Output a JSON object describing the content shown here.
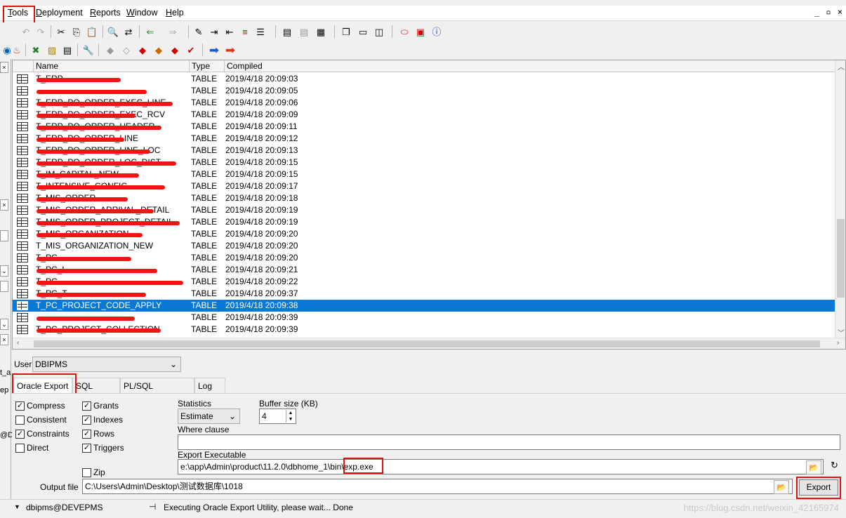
{
  "menu": {
    "tools": "Tools",
    "deployment": "Deployment",
    "reports": "Reports",
    "window": "Window",
    "help": "Help",
    "window_controls": "_ ▫ ×"
  },
  "grid": {
    "headers": {
      "name": "Name",
      "type": "Type",
      "compiled": "Compiled"
    },
    "rows": [
      {
        "name": "T_ERP",
        "type": "TABLE",
        "compiled": "2019/4/18 20:09:03"
      },
      {
        "name": "",
        "type": "TABLE",
        "compiled": "2019/4/18 20:09:05"
      },
      {
        "name": "T_ERP_PO_ORDER_EXEC_LINE",
        "type": "TABLE",
        "compiled": "2019/4/18 20:09:06"
      },
      {
        "name": "T_ERP_PO_ORDER_EXEC_RCV",
        "type": "TABLE",
        "compiled": "2019/4/18 20:09:09"
      },
      {
        "name": "T_ERP_PO_ORDER_HEADER",
        "type": "TABLE",
        "compiled": "2019/4/18 20:09:11"
      },
      {
        "name": "T_ERP_PO_ORDER_LINE",
        "type": "TABLE",
        "compiled": "2019/4/18 20:09:12"
      },
      {
        "name": "T_ERP_PO_ORDER_LINE_LOC",
        "type": "TABLE",
        "compiled": "2019/4/18 20:09:13"
      },
      {
        "name": "T_ERP_PO_ORDER_LOC_DIST",
        "type": "TABLE",
        "compiled": "2019/4/18 20:09:15"
      },
      {
        "name": "T_IM_CAPITAL_NEW",
        "type": "TABLE",
        "compiled": "2019/4/18 20:09:15"
      },
      {
        "name": "T_INTENSIVE_CONFIG",
        "type": "TABLE",
        "compiled": "2019/4/18 20:09:17"
      },
      {
        "name": "T_MIS_ORDER",
        "type": "TABLE",
        "compiled": "2019/4/18 20:09:18"
      },
      {
        "name": "T_MIS_ORDER_ARRIVAL_DETAIL",
        "type": "TABLE",
        "compiled": "2019/4/18 20:09:19"
      },
      {
        "name": "T_MIS_ORDER_PROJECT_DETAIL",
        "type": "TABLE",
        "compiled": "2019/4/18 20:09:19"
      },
      {
        "name": "T_MIS_ORGANIZATION",
        "type": "TABLE",
        "compiled": "2019/4/18 20:09:20"
      },
      {
        "name": "T_MIS_ORGANIZATION_NEW",
        "type": "TABLE",
        "compiled": "2019/4/18 20:09:20"
      },
      {
        "name": "T_PC",
        "type": "TABLE",
        "compiled": "2019/4/18 20:09:20"
      },
      {
        "name": "T_PC_L",
        "type": "TABLE",
        "compiled": "2019/4/18 20:09:21"
      },
      {
        "name": "T_PC",
        "type": "TABLE",
        "compiled": "2019/4/18 20:09:22"
      },
      {
        "name": "T_PC_T",
        "type": "TABLE",
        "compiled": "2019/4/18 20:09:37"
      },
      {
        "name": "T_PC_PROJECT_CODE_APPLY",
        "type": "TABLE",
        "compiled": "2019/4/18 20:09:38"
      },
      {
        "name": "",
        "type": "TABLE",
        "compiled": "2019/4/18 20:09:39"
      },
      {
        "name": "T_PC_PROJECT_COLLECTION",
        "type": "TABLE",
        "compiled": "2019/4/18 20:09:39"
      }
    ],
    "selected_index": 19
  },
  "left_strip": {
    "label_1": "t_a",
    "label_2": "ep",
    "label_3": "@D"
  },
  "user": {
    "label": "User",
    "value": "DBIPMS"
  },
  "tabs": [
    "Oracle Export",
    "SQL Inserts",
    "PL/SQL Developer",
    "Log"
  ],
  "options": {
    "compress": {
      "label": "Compress",
      "checked": true
    },
    "consistent": {
      "label": "Consistent",
      "checked": false
    },
    "constraints": {
      "label": "Constraints",
      "checked": true
    },
    "direct": {
      "label": "Direct",
      "checked": false
    },
    "grants": {
      "label": "Grants",
      "checked": true
    },
    "indexes": {
      "label": "Indexes",
      "checked": true
    },
    "rows": {
      "label": "Rows",
      "checked": true
    },
    "triggers": {
      "label": "Triggers",
      "checked": true
    },
    "zip": {
      "label": "Zip",
      "checked": false
    }
  },
  "statistics": {
    "label": "Statistics",
    "value": "Estimate"
  },
  "buffer": {
    "label": "Buffer size (KB)",
    "value": "4"
  },
  "where_clause": {
    "label": "Where clause",
    "value": ""
  },
  "executable": {
    "label": "Export Executable",
    "value": "e:\\app\\Admin\\product\\11.2.0\\dbhome_1\\bin\\exp.exe"
  },
  "output": {
    "label": "Output file",
    "value": "C:\\Users\\Admin\\Desktop\\测试数据库\\1018"
  },
  "export_button": "Export",
  "status": {
    "connection": "dbipms@DEVEPMS",
    "message": "Executing Oracle Export Utility, please wait...  Done"
  },
  "watermark": "https://blog.csdn.net/weixin_42165974"
}
